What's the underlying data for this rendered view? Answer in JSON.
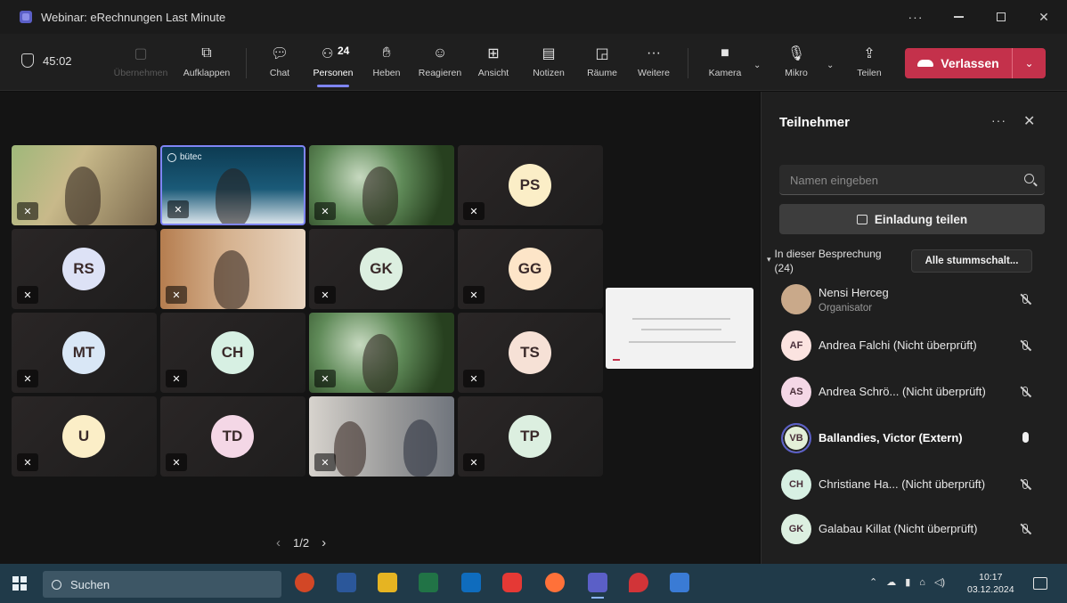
{
  "window": {
    "title": "Webinar: eRechnungen Last Minute"
  },
  "toolbar": {
    "timer": "45:02",
    "buttons": {
      "share": "Übernehmen",
      "popout": "Aufklappen",
      "chat": "Chat",
      "people": "Personen",
      "people_count": "24",
      "raise": "Heben",
      "react": "Reagieren",
      "view": "Ansicht",
      "notes": "Notizen",
      "rooms": "Räume",
      "more": "Weitere",
      "camera": "Kamera",
      "mic": "Mikro",
      "share_screen": "Teilen"
    },
    "leave": "Verlassen"
  },
  "stage": {
    "tiles": [
      {
        "initials": "",
        "type": "video"
      },
      {
        "initials": "",
        "type": "video",
        "brand": "bütec"
      },
      {
        "initials": "",
        "type": "video"
      },
      {
        "initials": "PS",
        "color": "#fbeec7"
      },
      {
        "initials": "RS",
        "color": "#dde2f6"
      },
      {
        "initials": "",
        "type": "video"
      },
      {
        "initials": "GK",
        "color": "#dcefe0"
      },
      {
        "initials": "GG",
        "color": "#fde5c8"
      },
      {
        "initials": "MT",
        "color": "#d9e7f6"
      },
      {
        "initials": "CH",
        "color": "#d7f0e3"
      },
      {
        "initials": "",
        "type": "video"
      },
      {
        "initials": "TS",
        "color": "#f6e1d6"
      },
      {
        "initials": "U",
        "color": "#fbeec7"
      },
      {
        "initials": "TD",
        "color": "#f4d7e6"
      },
      {
        "initials": "",
        "type": "video"
      },
      {
        "initials": "TP",
        "color": "#dcefe0"
      }
    ],
    "pager": "1/2"
  },
  "panel": {
    "title": "Teilnehmer",
    "search_placeholder": "Namen eingeben",
    "invite": "Einladung teilen",
    "section_label": "In dieser Besprechung",
    "section_count": "(24)",
    "mute_all": "Alle stummschalt...",
    "participants": [
      {
        "initials": "",
        "name": "Nensi Herceg",
        "role": "Organisator",
        "mic": "off",
        "color": "#c9a98a"
      },
      {
        "initials": "AF",
        "name": "Andrea Falchi (Nicht überprüft)",
        "role": "",
        "mic": "off",
        "color": "#fbe3e0"
      },
      {
        "initials": "AS",
        "name": "Andrea Schrö... (Nicht überprüft)",
        "role": "",
        "mic": "off",
        "color": "#f4d7e6"
      },
      {
        "initials": "VB",
        "name": "Ballandies, Victor (Extern)",
        "role": "",
        "mic": "on",
        "color": "#e3efd8"
      },
      {
        "initials": "CH",
        "name": "Christiane Ha... (Nicht überprüft)",
        "role": "",
        "mic": "off",
        "color": "#d7f0e3"
      },
      {
        "initials": "GK",
        "name": "Galabau Killat (Nicht überprüft)",
        "role": "",
        "mic": "off",
        "color": "#dcefe0"
      }
    ]
  },
  "taskbar": {
    "search": "Suchen",
    "time": "10:17",
    "date": "03.12.2024"
  }
}
